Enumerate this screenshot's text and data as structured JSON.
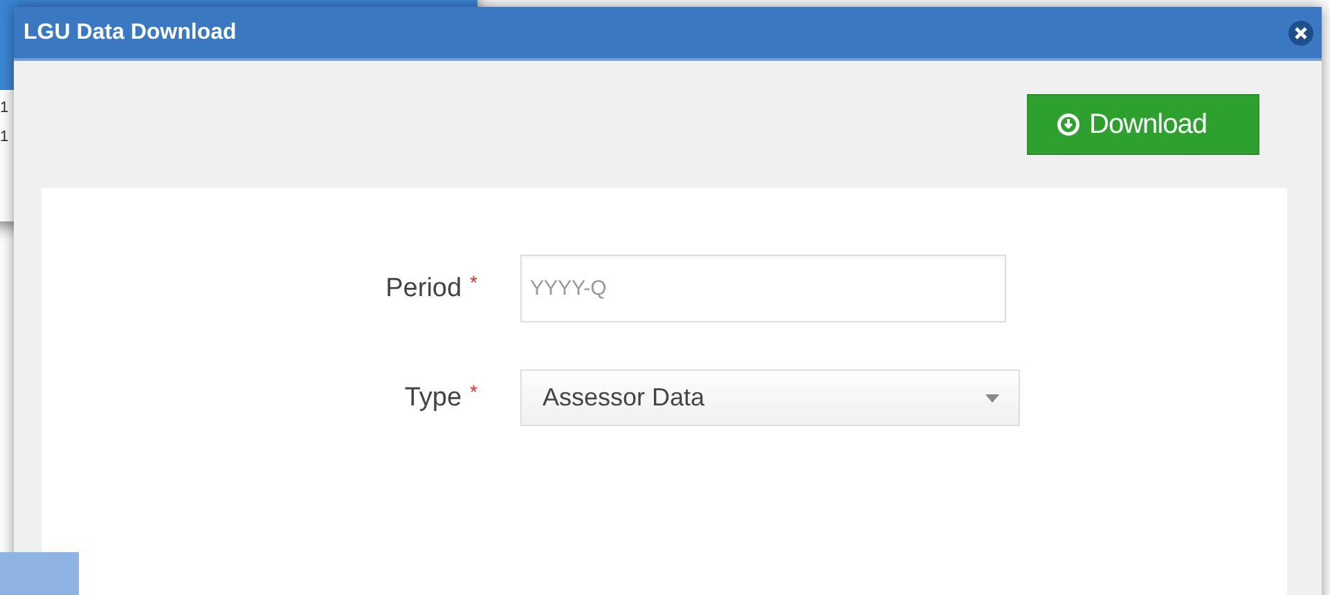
{
  "background_window": {
    "cells": [
      "1",
      "1"
    ]
  },
  "dialog": {
    "title": "LGU Data Download",
    "download_button": {
      "label": "Download"
    },
    "fields": [
      {
        "kind": "text",
        "label": "Period",
        "required_mark": "*",
        "placeholder": "YYYY-Q"
      },
      {
        "kind": "select",
        "label": "Type",
        "required_mark": "*",
        "value": "Assessor Data"
      }
    ]
  }
}
